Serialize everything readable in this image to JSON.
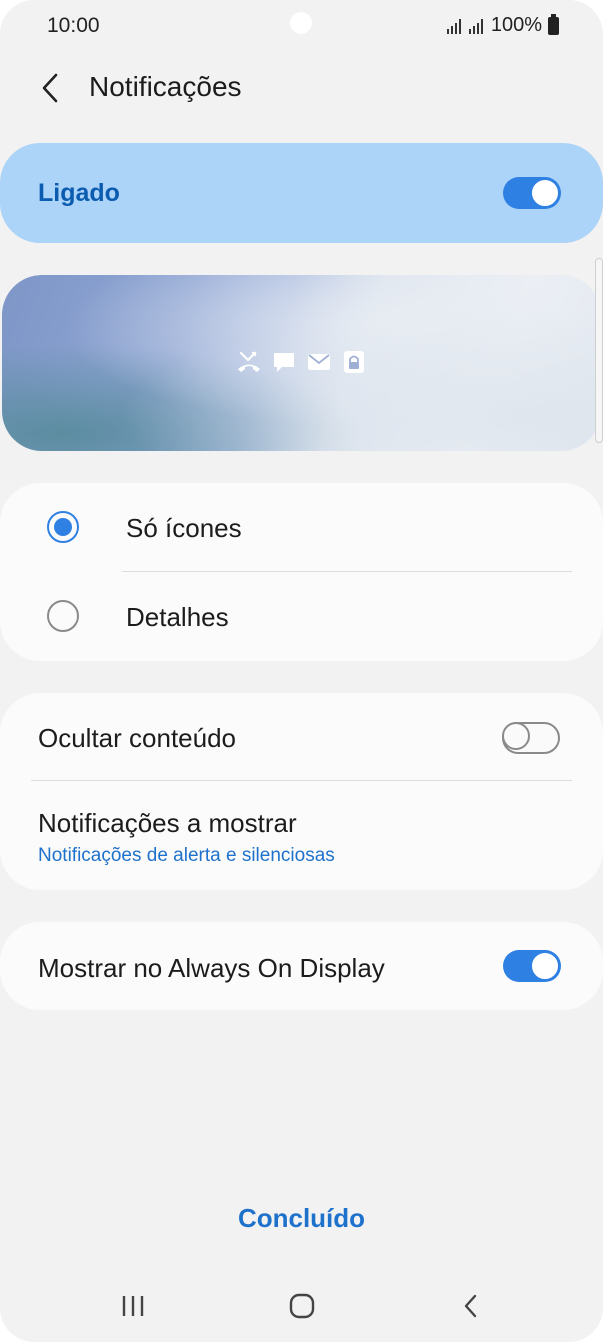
{
  "status_bar": {
    "time": "10:00",
    "battery": "100%"
  },
  "header": {
    "title": "Notificações",
    "back_icon": "chevron-left-icon"
  },
  "master_switch": {
    "label": "Ligado",
    "enabled": true
  },
  "preview": {
    "icons": [
      "missed-call-icon",
      "chat-bubble-icon",
      "envelope-icon",
      "lock-icon"
    ]
  },
  "style_options": {
    "items": [
      {
        "label": "Só ícones",
        "selected": true
      },
      {
        "label": "Detalhes",
        "selected": false
      }
    ]
  },
  "content_settings": {
    "hide_content": {
      "label": "Ocultar conteúdo",
      "enabled": false
    },
    "notifications_to_show": {
      "label": "Notificações a mostrar",
      "value": "Notificações de alerta e silenciosas"
    }
  },
  "aod": {
    "label": "Mostrar no Always On Display",
    "enabled": true
  },
  "footer": {
    "done_label": "Concluído"
  },
  "nav_bar": {
    "buttons": [
      "recent-apps-icon",
      "home-icon",
      "back-icon"
    ]
  },
  "colors": {
    "accent": "#2f80e3",
    "master_bg": "#acd3f8",
    "link": "#1f72cc"
  }
}
